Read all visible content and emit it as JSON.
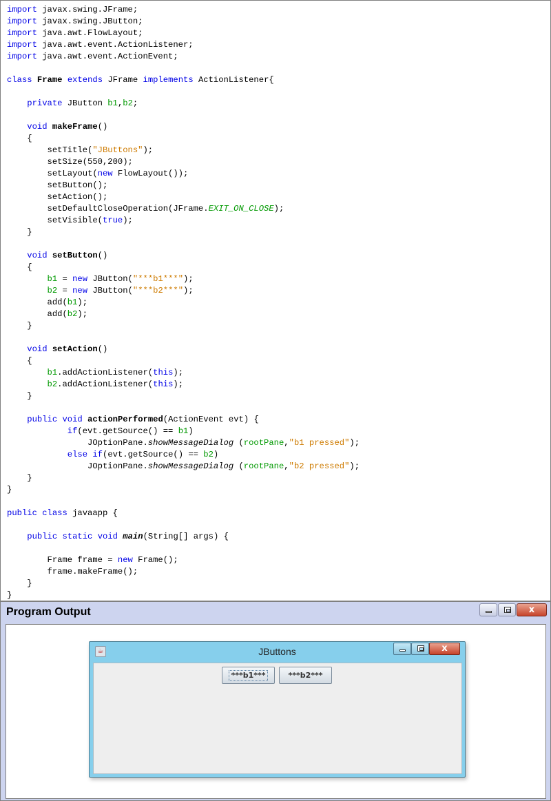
{
  "code": {
    "lines": [
      [
        [
          "kw",
          "import"
        ],
        [
          "t",
          " javax.swing.JFrame;"
        ]
      ],
      [
        [
          "kw",
          "import"
        ],
        [
          "t",
          " javax.swing.JButton;"
        ]
      ],
      [
        [
          "kw",
          "import"
        ],
        [
          "t",
          " java.awt.FlowLayout;"
        ]
      ],
      [
        [
          "kw",
          "import"
        ],
        [
          "t",
          " java.awt.event.ActionListener;"
        ]
      ],
      [
        [
          "kw",
          "import"
        ],
        [
          "t",
          " java.awt.event.ActionEvent;"
        ]
      ],
      [],
      [
        [
          "kw",
          "class"
        ],
        [
          "t",
          " "
        ],
        [
          "bold",
          "Frame"
        ],
        [
          "t",
          " "
        ],
        [
          "kw",
          "extends"
        ],
        [
          "t",
          " JFrame "
        ],
        [
          "kw",
          "implements"
        ],
        [
          "t",
          " ActionListener{"
        ]
      ],
      [],
      [
        [
          "t",
          "    "
        ],
        [
          "kw",
          "private"
        ],
        [
          "t",
          " JButton "
        ],
        [
          "fld",
          "b1"
        ],
        [
          "t",
          ","
        ],
        [
          "fld",
          "b2"
        ],
        [
          "t",
          ";"
        ]
      ],
      [],
      [
        [
          "t",
          "    "
        ],
        [
          "kw",
          "void"
        ],
        [
          "t",
          " "
        ],
        [
          "bold",
          "makeFrame"
        ],
        [
          "t",
          "()"
        ]
      ],
      [
        [
          "t",
          "    {"
        ]
      ],
      [
        [
          "t",
          "        setTitle("
        ],
        [
          "str",
          "\"JButtons\""
        ],
        [
          "t",
          ");"
        ]
      ],
      [
        [
          "t",
          "        setSize(550,200);"
        ]
      ],
      [
        [
          "t",
          "        setLayout("
        ],
        [
          "kw",
          "new"
        ],
        [
          "t",
          " FlowLayout());"
        ]
      ],
      [
        [
          "t",
          "        setButton();"
        ]
      ],
      [
        [
          "t",
          "        setAction();"
        ]
      ],
      [
        [
          "t",
          "        setDefaultCloseOperation(JFrame."
        ],
        [
          "sfld",
          "EXIT_ON_CLOSE"
        ],
        [
          "t",
          ");"
        ]
      ],
      [
        [
          "t",
          "        setVisible("
        ],
        [
          "kw",
          "true"
        ],
        [
          "t",
          ");"
        ]
      ],
      [
        [
          "t",
          "    }"
        ]
      ],
      [],
      [
        [
          "t",
          "    "
        ],
        [
          "kw",
          "void"
        ],
        [
          "t",
          " "
        ],
        [
          "bold",
          "setButton"
        ],
        [
          "t",
          "()"
        ]
      ],
      [
        [
          "t",
          "    {"
        ]
      ],
      [
        [
          "t",
          "        "
        ],
        [
          "fld",
          "b1"
        ],
        [
          "t",
          " = "
        ],
        [
          "kw",
          "new"
        ],
        [
          "t",
          " JButton("
        ],
        [
          "str",
          "\"***b1***\""
        ],
        [
          "t",
          ");"
        ]
      ],
      [
        [
          "t",
          "        "
        ],
        [
          "fld",
          "b2"
        ],
        [
          "t",
          " = "
        ],
        [
          "kw",
          "new"
        ],
        [
          "t",
          " JButton("
        ],
        [
          "str",
          "\"***b2***\""
        ],
        [
          "t",
          ");"
        ]
      ],
      [
        [
          "t",
          "        add("
        ],
        [
          "fld",
          "b1"
        ],
        [
          "t",
          ");"
        ]
      ],
      [
        [
          "t",
          "        add("
        ],
        [
          "fld",
          "b2"
        ],
        [
          "t",
          ");"
        ]
      ],
      [
        [
          "t",
          "    }"
        ]
      ],
      [],
      [
        [
          "t",
          "    "
        ],
        [
          "kw",
          "void"
        ],
        [
          "t",
          " "
        ],
        [
          "bold",
          "setAction"
        ],
        [
          "t",
          "()"
        ]
      ],
      [
        [
          "t",
          "    {"
        ]
      ],
      [
        [
          "t",
          "        "
        ],
        [
          "fld",
          "b1"
        ],
        [
          "t",
          ".addActionListener("
        ],
        [
          "kw",
          "this"
        ],
        [
          "t",
          ");"
        ]
      ],
      [
        [
          "t",
          "        "
        ],
        [
          "fld",
          "b2"
        ],
        [
          "t",
          ".addActionListener("
        ],
        [
          "kw",
          "this"
        ],
        [
          "t",
          ");"
        ]
      ],
      [
        [
          "t",
          "    }"
        ]
      ],
      [],
      [
        [
          "t",
          "    "
        ],
        [
          "kw",
          "public"
        ],
        [
          "t",
          " "
        ],
        [
          "kw",
          "void"
        ],
        [
          "t",
          " "
        ],
        [
          "bold",
          "actionPerformed"
        ],
        [
          "t",
          "(ActionEvent evt) {"
        ]
      ],
      [
        [
          "t",
          "            "
        ],
        [
          "kw",
          "if"
        ],
        [
          "t",
          "(evt.getSource() == "
        ],
        [
          "fld",
          "b1"
        ],
        [
          "t",
          ")"
        ]
      ],
      [
        [
          "t",
          "                JOptionPane."
        ],
        [
          "it",
          "showMessageDialog"
        ],
        [
          "t",
          " ("
        ],
        [
          "fld",
          "rootPane"
        ],
        [
          "t",
          ","
        ],
        [
          "str",
          "\"b1 pressed\""
        ],
        [
          "t",
          ");"
        ]
      ],
      [
        [
          "t",
          "            "
        ],
        [
          "kw",
          "else"
        ],
        [
          "t",
          " "
        ],
        [
          "kw",
          "if"
        ],
        [
          "t",
          "(evt.getSource() == "
        ],
        [
          "fld",
          "b2"
        ],
        [
          "t",
          ")"
        ]
      ],
      [
        [
          "t",
          "                JOptionPane."
        ],
        [
          "it",
          "showMessageDialog"
        ],
        [
          "t",
          " ("
        ],
        [
          "fld",
          "rootPane"
        ],
        [
          "t",
          ","
        ],
        [
          "str",
          "\"b2 pressed\""
        ],
        [
          "t",
          ");"
        ]
      ],
      [
        [
          "t",
          "    }"
        ]
      ],
      [
        [
          "t",
          "}"
        ]
      ],
      [],
      [
        [
          "kw",
          "public"
        ],
        [
          "t",
          " "
        ],
        [
          "kw",
          "class"
        ],
        [
          "t",
          " javaapp {"
        ]
      ],
      [],
      [
        [
          "t",
          "    "
        ],
        [
          "kw",
          "public"
        ],
        [
          "t",
          " "
        ],
        [
          "kw",
          "static"
        ],
        [
          "t",
          " "
        ],
        [
          "kw",
          "void"
        ],
        [
          "t",
          " "
        ],
        [
          "bi",
          "main"
        ],
        [
          "t",
          "(String[] args) {"
        ]
      ],
      [],
      [
        [
          "t",
          "        Frame frame = "
        ],
        [
          "kw",
          "new"
        ],
        [
          "t",
          " Frame();"
        ]
      ],
      [
        [
          "t",
          "        frame.makeFrame();"
        ]
      ],
      [
        [
          "t",
          "    }"
        ]
      ],
      [
        [
          "t",
          "}"
        ]
      ]
    ]
  },
  "output": {
    "title": "Program Output",
    "close_glyph": "x",
    "jframe": {
      "title": "JButtons",
      "close_glyph": "x",
      "buttons": [
        {
          "label": "***b1***",
          "focused": true
        },
        {
          "label": "***b2***",
          "focused": false
        }
      ]
    }
  },
  "colors": {
    "keyword": "#0000e6",
    "string": "#ce7b00",
    "field": "#009900",
    "output_chrome": "#cdd4ef",
    "jframe_chrome": "#86cfec",
    "close_button": "#c7442b"
  }
}
